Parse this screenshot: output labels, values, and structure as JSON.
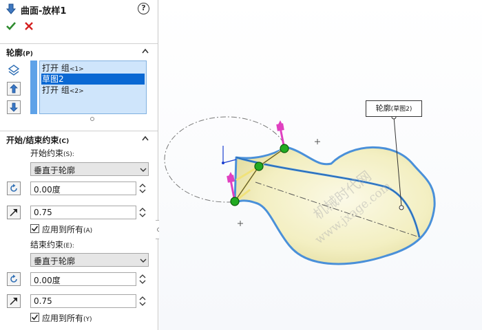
{
  "header": {
    "title": "曲面-放样1",
    "help": "?"
  },
  "profiles_section": {
    "title": "轮廓",
    "key": "(P)",
    "items": [
      {
        "main": "打开 组",
        "sub": "<1>",
        "selected": false
      },
      {
        "main": "草图2",
        "sub": "",
        "selected": true
      },
      {
        "main": "打开 组",
        "sub": "<2>",
        "selected": false
      }
    ]
  },
  "constraints_section": {
    "title": "开始/结束约束",
    "key": "(C)",
    "start": {
      "label": "开始约束",
      "key": "(S):",
      "type_value": "垂直于轮廓",
      "angle_value": "0.00度",
      "length_value": "0.75",
      "apply_all_label": "应用到所有",
      "apply_all_key": "(A)",
      "apply_all_checked": true
    },
    "end": {
      "label": "结束约束",
      "key": "(E):",
      "type_value": "垂直于轮廓",
      "angle_value": "0.00度",
      "length_value": "0.75",
      "apply_all_label": "应用到所有",
      "apply_all_key": "(Y)",
      "apply_all_checked": true
    }
  },
  "viewport": {
    "callout_main": "轮廓",
    "callout_sub": "(草图2)",
    "watermark_1": "机械时代网",
    "watermark_2": "www.jxage.com"
  },
  "colors": {
    "accent": "#0a68d3",
    "list_bg": "#cfe5fb",
    "ok_green": "#2e8b2e",
    "cancel_red": "#d42020",
    "edge_blue": "#4a90d9",
    "handle_magenta": "#e040c0",
    "point_green": "#22aa22"
  }
}
